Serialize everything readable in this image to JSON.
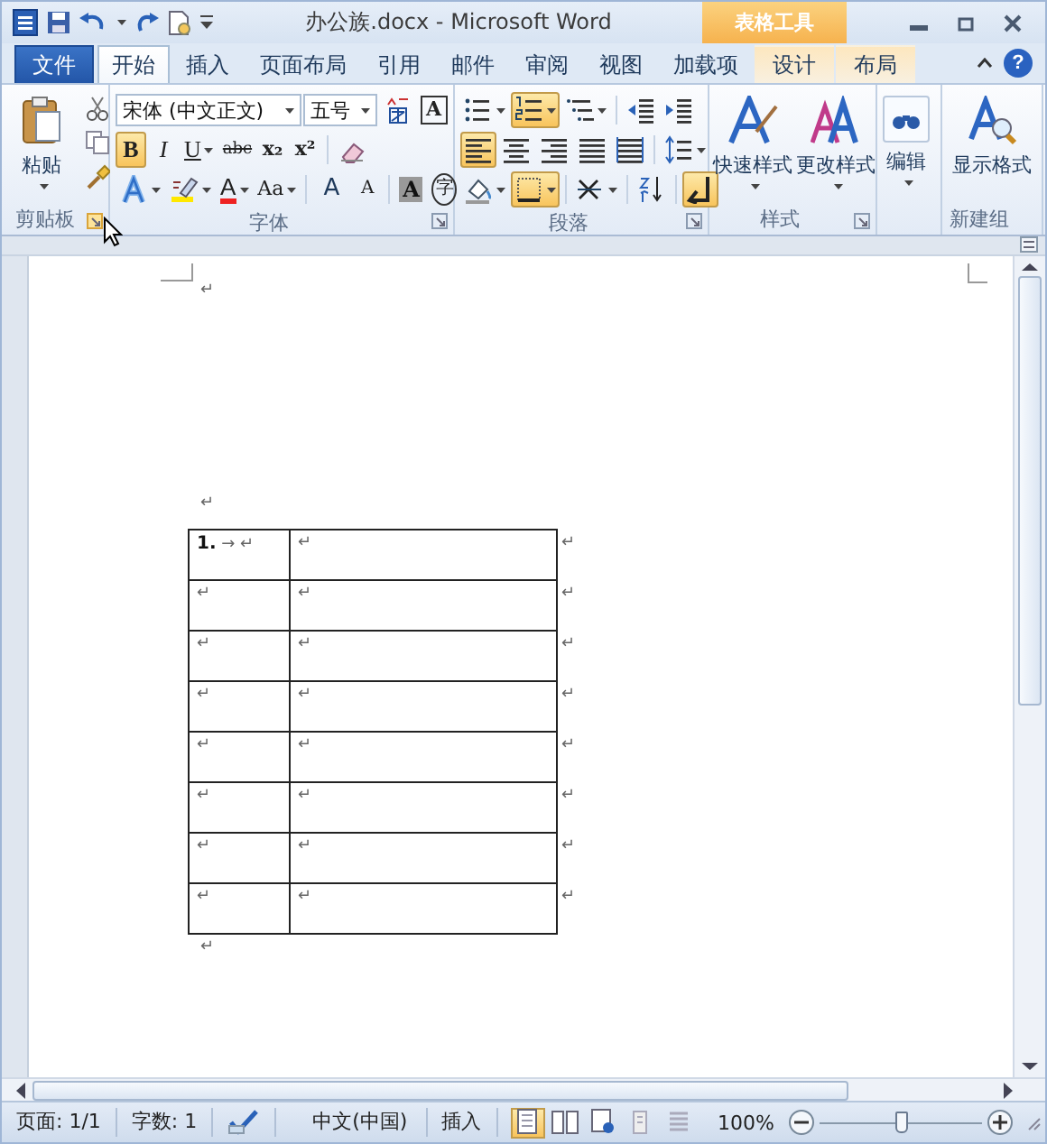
{
  "title_bar": {
    "title": "办公族.docx - Microsoft Word",
    "context_group": "表格工具"
  },
  "tabs": [
    {
      "label": "文件",
      "kind": "file",
      "selected": false
    },
    {
      "label": "开始",
      "kind": "normal",
      "selected": true
    },
    {
      "label": "插入",
      "kind": "normal",
      "selected": false
    },
    {
      "label": "页面布局",
      "kind": "normal",
      "selected": false
    },
    {
      "label": "引用",
      "kind": "normal",
      "selected": false
    },
    {
      "label": "邮件",
      "kind": "normal",
      "selected": false
    },
    {
      "label": "审阅",
      "kind": "normal",
      "selected": false
    },
    {
      "label": "视图",
      "kind": "normal",
      "selected": false
    },
    {
      "label": "加载项",
      "kind": "normal",
      "selected": false
    },
    {
      "label": "设计",
      "kind": "contextual",
      "selected": false
    },
    {
      "label": "布局",
      "kind": "contextual",
      "selected": false
    }
  ],
  "help": "?",
  "ribbon": {
    "clipboard": {
      "label": "剪贴板",
      "paste": "粘贴",
      "launcher_highlighted": true
    },
    "font": {
      "label": "字体",
      "font_name": "宋体 (中文正文)",
      "font_size": "五号",
      "launcher_highlighted": false,
      "row1": [
        {
          "selected": false
        },
        {
          "text": "A",
          "selected": false
        }
      ],
      "row2": [
        {
          "text": "B",
          "selected": true
        },
        {
          "text": "I",
          "selected": false
        },
        {
          "text": "U",
          "selected": false
        },
        {
          "text": "abc",
          "selected": false
        },
        {
          "text": "x₂",
          "selected": false
        },
        {
          "text": "x²",
          "selected": false
        },
        {
          "selected": false
        }
      ],
      "row3": [
        {
          "selected": false
        },
        {
          "selected": false
        },
        {
          "text": "A",
          "selected": false
        },
        {
          "text": "Aa",
          "selected": false
        },
        {
          "text": "A",
          "selected": false
        },
        {
          "text": "A",
          "selected": false
        },
        {
          "text": "A",
          "selected": false
        },
        {
          "text": "字",
          "selected": false
        }
      ]
    },
    "paragraph": {
      "label": "段落",
      "launcher_highlighted": false,
      "row1": [
        {
          "selected": false
        },
        {
          "selected": true
        },
        {
          "selected": false
        },
        {
          "selected": false
        },
        {
          "selected": false
        }
      ],
      "row2": [
        {
          "selected": true
        },
        {
          "selected": false
        },
        {
          "selected": false
        },
        {
          "selected": false
        },
        {
          "selected": false
        },
        {
          "selected": false
        }
      ],
      "row3": [
        {
          "selected": false
        },
        {
          "selected": true
        },
        {
          "selected": false
        },
        {
          "selected": false
        },
        {
          "selected": true
        }
      ]
    },
    "styles": {
      "label": "样式",
      "buttons": [
        "快速样式",
        "更改样式"
      ],
      "launcher_highlighted": false
    },
    "editing": {
      "button": "编辑"
    },
    "new_group": {
      "label": "新建组",
      "button": "显示格式"
    }
  },
  "document": {
    "blocks": [
      {
        "kind": "paragraph",
        "text": "↵"
      },
      {
        "kind": "paragraph",
        "text": "↵"
      },
      {
        "kind": "table",
        "rows": [
          {
            "cells": [
              "**1.** → ↵",
              "↵"
            ],
            "end_mark": "↵"
          },
          {
            "cells": [
              "↵",
              "↵"
            ],
            "end_mark": "↵"
          },
          {
            "cells": [
              "↵",
              "↵"
            ],
            "end_mark": "↵"
          },
          {
            "cells": [
              "↵",
              "↵"
            ],
            "end_mark": "↵"
          },
          {
            "cells": [
              "↵",
              "↵"
            ],
            "end_mark": "↵"
          },
          {
            "cells": [
              "↵",
              "↵"
            ],
            "end_mark": "↵"
          },
          {
            "cells": [
              "↵",
              "↵"
            ],
            "end_mark": "↵"
          },
          {
            "cells": [
              "↵",
              "↵"
            ],
            "end_mark": "↵"
          }
        ]
      },
      {
        "kind": "paragraph",
        "text": "↵"
      }
    ]
  },
  "status_bar": {
    "page": "页面: 1/1",
    "words": "字数: 1",
    "language": "中文(中国)",
    "mode": "插入",
    "views": [
      {
        "selected": true
      },
      {
        "selected": false
      },
      {
        "selected": false
      },
      {
        "selected": false
      },
      {
        "selected": false
      }
    ],
    "zoom": "100%",
    "zoom_slider": {
      "level": 0.5
    }
  }
}
